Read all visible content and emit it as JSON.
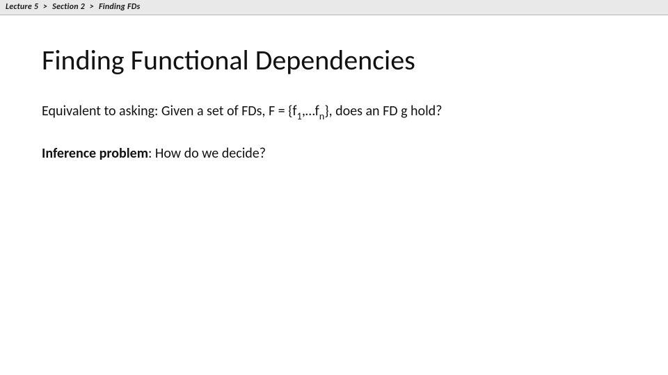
{
  "breadcrumb": {
    "item1": "Lecture 5",
    "sep": ">",
    "item2": "Section 2",
    "item3": "Finding FDs"
  },
  "title": "Finding Functional Dependencies",
  "line1": {
    "prefix": "Equivalent to asking: Given a set of FDs, F = {f",
    "sub1": "1",
    "mid": ",…f",
    "sub2": "n",
    "suffix": "}, does an FD g hold?"
  },
  "line2": {
    "bold": "Inference problem",
    "rest": ": How do we decide?"
  }
}
